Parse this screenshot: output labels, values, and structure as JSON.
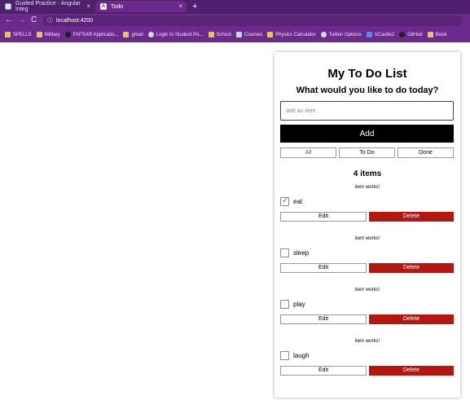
{
  "browser": {
    "tabs": [
      {
        "label": "Guided Practice - Angular Integ",
        "close": "×"
      },
      {
        "label": "Todo",
        "close": "×"
      }
    ],
    "new_tab": "+",
    "nav": {
      "back": "←",
      "forward": "→",
      "reload": "C"
    },
    "url": "localhost:4200",
    "bookmarks": [
      {
        "label": "SPELLS",
        "icon": "folder-icon"
      },
      {
        "label": "Military",
        "icon": "folder-icon"
      },
      {
        "label": "FAFSA® Applicatio...",
        "icon": "fafsa-icon"
      },
      {
        "label": "gmail",
        "icon": "folder-icon"
      },
      {
        "label": "Login to Student Po...",
        "icon": "globe-icon"
      },
      {
        "label": "School",
        "icon": "folder-icon"
      },
      {
        "label": "Courses",
        "icon": "shield-icon"
      },
      {
        "label": "Physics Calculator",
        "icon": "folder-icon"
      },
      {
        "label": "Tuition Options",
        "icon": "page-icon"
      },
      {
        "label": "VCastle2",
        "icon": "v-icon"
      },
      {
        "label": "GitHub",
        "icon": "github-icon"
      },
      {
        "label": "Book",
        "icon": "folder-icon"
      }
    ]
  },
  "app": {
    "title": "My To Do List",
    "subtitle": "What would you like to do today?",
    "input_placeholder": "add an item",
    "add_label": "Add",
    "filters": {
      "all": "All",
      "todo": "To Do",
      "done": "Done"
    },
    "count_label": "4 items",
    "items": [
      {
        "status": "item works!",
        "name": "eat",
        "done": true,
        "edit": "Edit",
        "delete": "Delete"
      },
      {
        "status": "item works!",
        "name": "sleep",
        "done": false,
        "edit": "Edit",
        "delete": "Delete"
      },
      {
        "status": "item works!",
        "name": "play",
        "done": false,
        "edit": "Edit",
        "delete": "Delete"
      },
      {
        "status": "item works!",
        "name": "laugh",
        "done": false,
        "edit": "Edit",
        "delete": "Delete"
      }
    ]
  },
  "colors": {
    "chrome": "#6c2b8c",
    "delete": "#b3170f",
    "add": "#000000",
    "all_filter_text": "#2f7d2f",
    "checkmark": "#3a78d8"
  }
}
